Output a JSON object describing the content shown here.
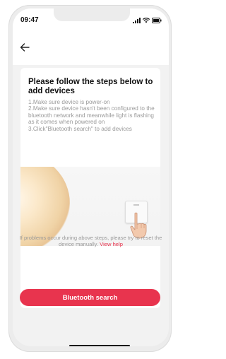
{
  "status_bar": {
    "time": "09:47"
  },
  "nav": {
    "back_icon": "arrow-left-icon"
  },
  "content": {
    "title": "Please follow the steps below to add devices",
    "steps": [
      "1.Make sure device is power-on",
      "2.Make sure device hasn't been configured to the bluetooth network and meanwhile light is flashing as it comes when powered on",
      "3.Click\"Bluetooth search\" to add devices"
    ]
  },
  "help": {
    "text": "If problems occur during above steps, please try to reset the device manually.",
    "link_label": "View help"
  },
  "actions": {
    "bluetooth_search_label": "Bluetooth search"
  },
  "colors": {
    "accent": "#e8344e",
    "background": "#f2f2f2",
    "muted_text": "#9a9a9a"
  }
}
